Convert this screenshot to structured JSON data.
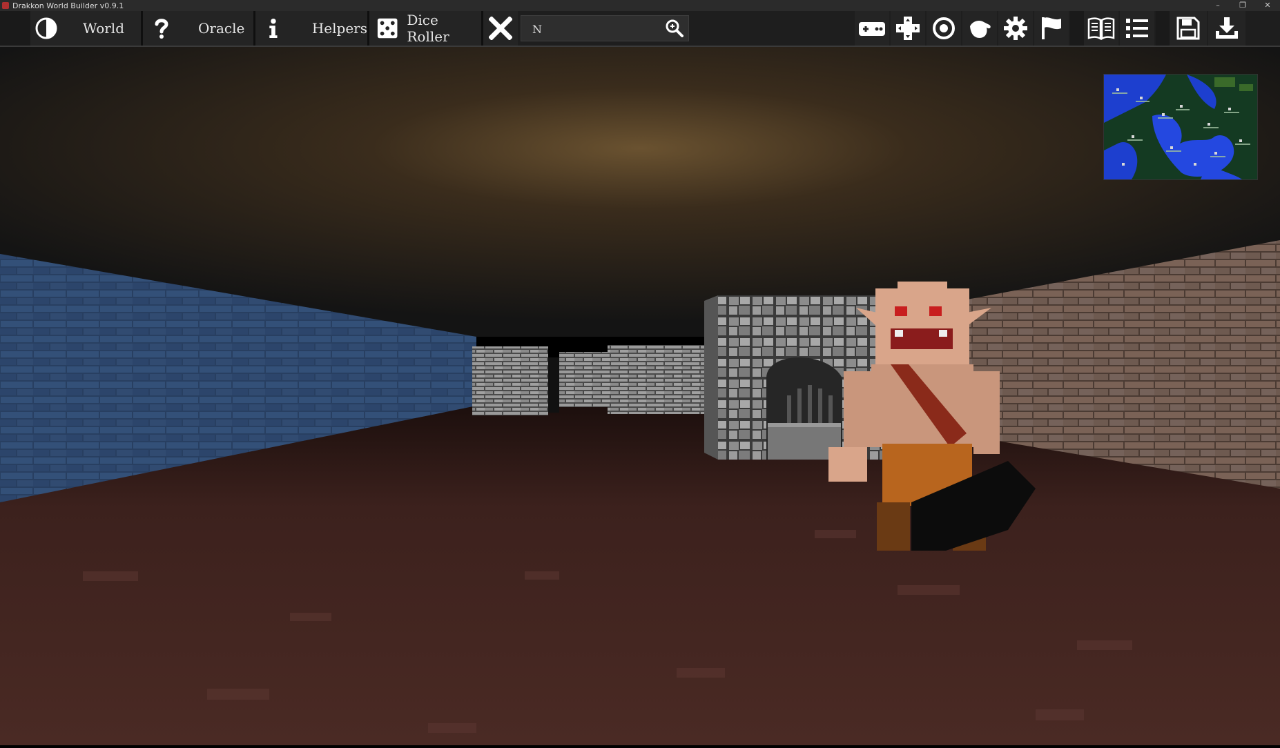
{
  "window": {
    "title": "Drakkon World Builder v0.9.1",
    "controls": [
      "–",
      "❐",
      "✕"
    ]
  },
  "toolbar": {
    "world_label": "World",
    "oracle_label": "Oracle",
    "helpers_label": "Helpers",
    "dice_label": "Dice Roller",
    "search_value": "N",
    "right_icons": [
      "gamepad-icon",
      "dpad-icon",
      "target-icon",
      "hand-icon",
      "gear-icon",
      "flag-icon",
      "book-icon",
      "list-icon",
      "save-icon",
      "download-icon"
    ]
  },
  "scene": {
    "description": "first-person dungeon corridor with goblin"
  },
  "colors": {
    "toolbar_bg": "#1e1e1e",
    "button_bg": "#242424",
    "text": "#e6e6e6"
  }
}
